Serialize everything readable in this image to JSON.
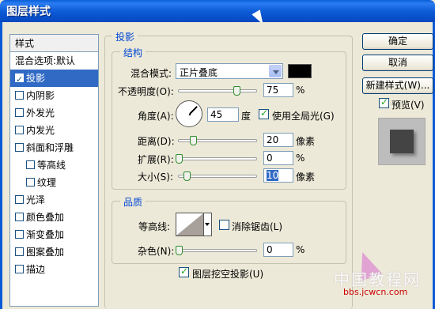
{
  "window": {
    "title": "图层样式"
  },
  "style_list": {
    "header": "样式",
    "items": [
      {
        "label": "混合选项:默认",
        "checkbox": false,
        "checked": false,
        "selected": false,
        "indent": false
      },
      {
        "label": "投影",
        "checkbox": true,
        "checked": true,
        "selected": true,
        "indent": false
      },
      {
        "label": "内阴影",
        "checkbox": true,
        "checked": false,
        "selected": false,
        "indent": false
      },
      {
        "label": "外发光",
        "checkbox": true,
        "checked": false,
        "selected": false,
        "indent": false
      },
      {
        "label": "内发光",
        "checkbox": true,
        "checked": false,
        "selected": false,
        "indent": false
      },
      {
        "label": "斜面和浮雕",
        "checkbox": true,
        "checked": false,
        "selected": false,
        "indent": false
      },
      {
        "label": "等高线",
        "checkbox": true,
        "checked": false,
        "selected": false,
        "indent": true
      },
      {
        "label": "纹理",
        "checkbox": true,
        "checked": false,
        "selected": false,
        "indent": true
      },
      {
        "label": "光泽",
        "checkbox": true,
        "checked": false,
        "selected": false,
        "indent": false
      },
      {
        "label": "颜色叠加",
        "checkbox": true,
        "checked": false,
        "selected": false,
        "indent": false
      },
      {
        "label": "渐变叠加",
        "checkbox": true,
        "checked": false,
        "selected": false,
        "indent": false
      },
      {
        "label": "图案叠加",
        "checkbox": true,
        "checked": false,
        "selected": false,
        "indent": false
      },
      {
        "label": "描边",
        "checkbox": true,
        "checked": false,
        "selected": false,
        "indent": false
      }
    ]
  },
  "drop_shadow": {
    "section_title": "投影",
    "structure": {
      "title": "结构",
      "blend_mode_label": "混合模式:",
      "blend_mode_value": "正片叠底",
      "shadow_color": "#000000",
      "opacity_label": "不透明度(O):",
      "opacity_value": "75",
      "opacity_unit": "%",
      "opacity_fraction": 0.75,
      "angle_label": "角度(A):",
      "angle_value": "45",
      "angle_unit": "度",
      "global_light_label": "使用全局光(G)",
      "global_light_checked": true,
      "distance_label": "距离(D):",
      "distance_value": "20",
      "distance_unit": "像素",
      "spread_label": "扩展(R):",
      "spread_value": "0",
      "spread_unit": "%",
      "size_label": "大小(S):",
      "size_value": "10",
      "size_unit": "像素"
    },
    "quality": {
      "title": "品质",
      "contour_label": "等高线:",
      "anti_alias_label": "消除锯齿(L)",
      "anti_alias_checked": false,
      "noise_label": "杂色(N):",
      "noise_value": "0",
      "noise_unit": "%",
      "knockout_label": "图层挖空投影(U)",
      "knockout_checked": true
    }
  },
  "buttons": {
    "ok": "确定",
    "cancel": "取消",
    "new_style": "新建样式(W)...",
    "preview_label": "预览(V)",
    "preview_checked": true
  },
  "watermark": {
    "line1": "中国教程网",
    "line2": "bbs.jcwcn.com"
  }
}
